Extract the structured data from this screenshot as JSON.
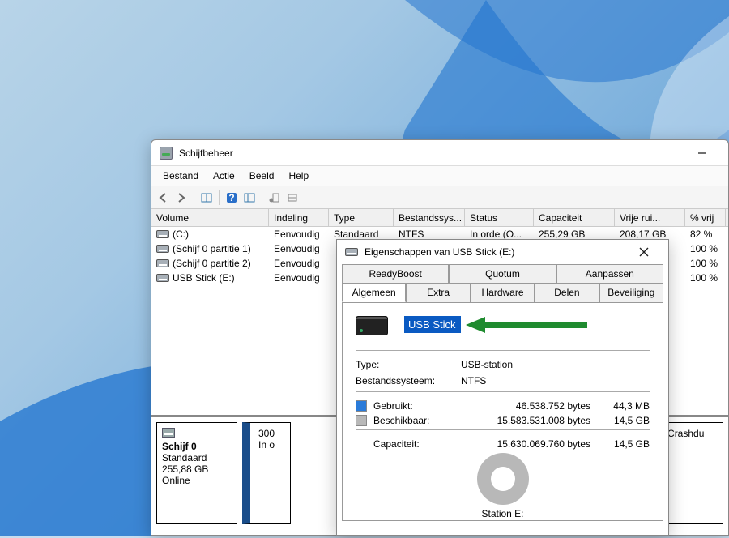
{
  "disk_mgmt": {
    "title": "Schijfbeheer",
    "menu": [
      "Bestand",
      "Actie",
      "Beeld",
      "Help"
    ],
    "columns": [
      "Volume",
      "Indeling",
      "Type",
      "Bestandssys...",
      "Status",
      "Capaciteit",
      "Vrije rui...",
      "% vrij"
    ],
    "rows": [
      {
        "name": "(C:)",
        "layout": "Eenvoudig",
        "type": "Standaard",
        "fs": "NTFS",
        "status": "In orde (O...",
        "cap": "255,29 GB",
        "free": "208,17 GB",
        "pct": "82 %"
      },
      {
        "name": "(Schijf 0 partitie 1)",
        "layout": "Eenvoudig",
        "type": "",
        "fs": "",
        "status": "",
        "cap": "",
        "free": "",
        "pct": "100 %"
      },
      {
        "name": "(Schijf 0 partitie 2)",
        "layout": "Eenvoudig",
        "type": "",
        "fs": "",
        "status": "",
        "cap": "",
        "free": "",
        "pct": "100 %"
      },
      {
        "name": "USB Stick (E:)",
        "layout": "Eenvoudig",
        "type": "",
        "fs": "",
        "status": "",
        "cap": "",
        "free": "",
        "pct": "100 %"
      }
    ],
    "disk0": {
      "title": "Schijf 0",
      "type": "Standaard",
      "size": "255,88 GB",
      "status": "Online",
      "part_left": "300\nIn o",
      "part_right": "tand, Crashdu"
    }
  },
  "props": {
    "title": "Eigenschappen van USB Stick (E:)",
    "tabs_back": [
      "ReadyBoost",
      "Quotum",
      "Aanpassen"
    ],
    "tabs_front": [
      "Algemeen",
      "Extra",
      "Hardware",
      "Delen",
      "Beveiliging"
    ],
    "active_tab": "Algemeen",
    "general": {
      "name_value": "USB Stick",
      "type_label": "Type:",
      "type_value": "USB-station",
      "fs_label": "Bestandssysteem:",
      "fs_value": "NTFS",
      "used_label": "Gebruikt:",
      "used_bytes": "46.538.752 bytes",
      "used_size": "44,3 MB",
      "free_label": "Beschikbaar:",
      "free_bytes": "15.583.531.008 bytes",
      "free_size": "14,5 GB",
      "cap_label": "Capaciteit:",
      "cap_bytes": "15.630.069.760 bytes",
      "cap_size": "14,5 GB",
      "station_label": "Station E:"
    }
  }
}
